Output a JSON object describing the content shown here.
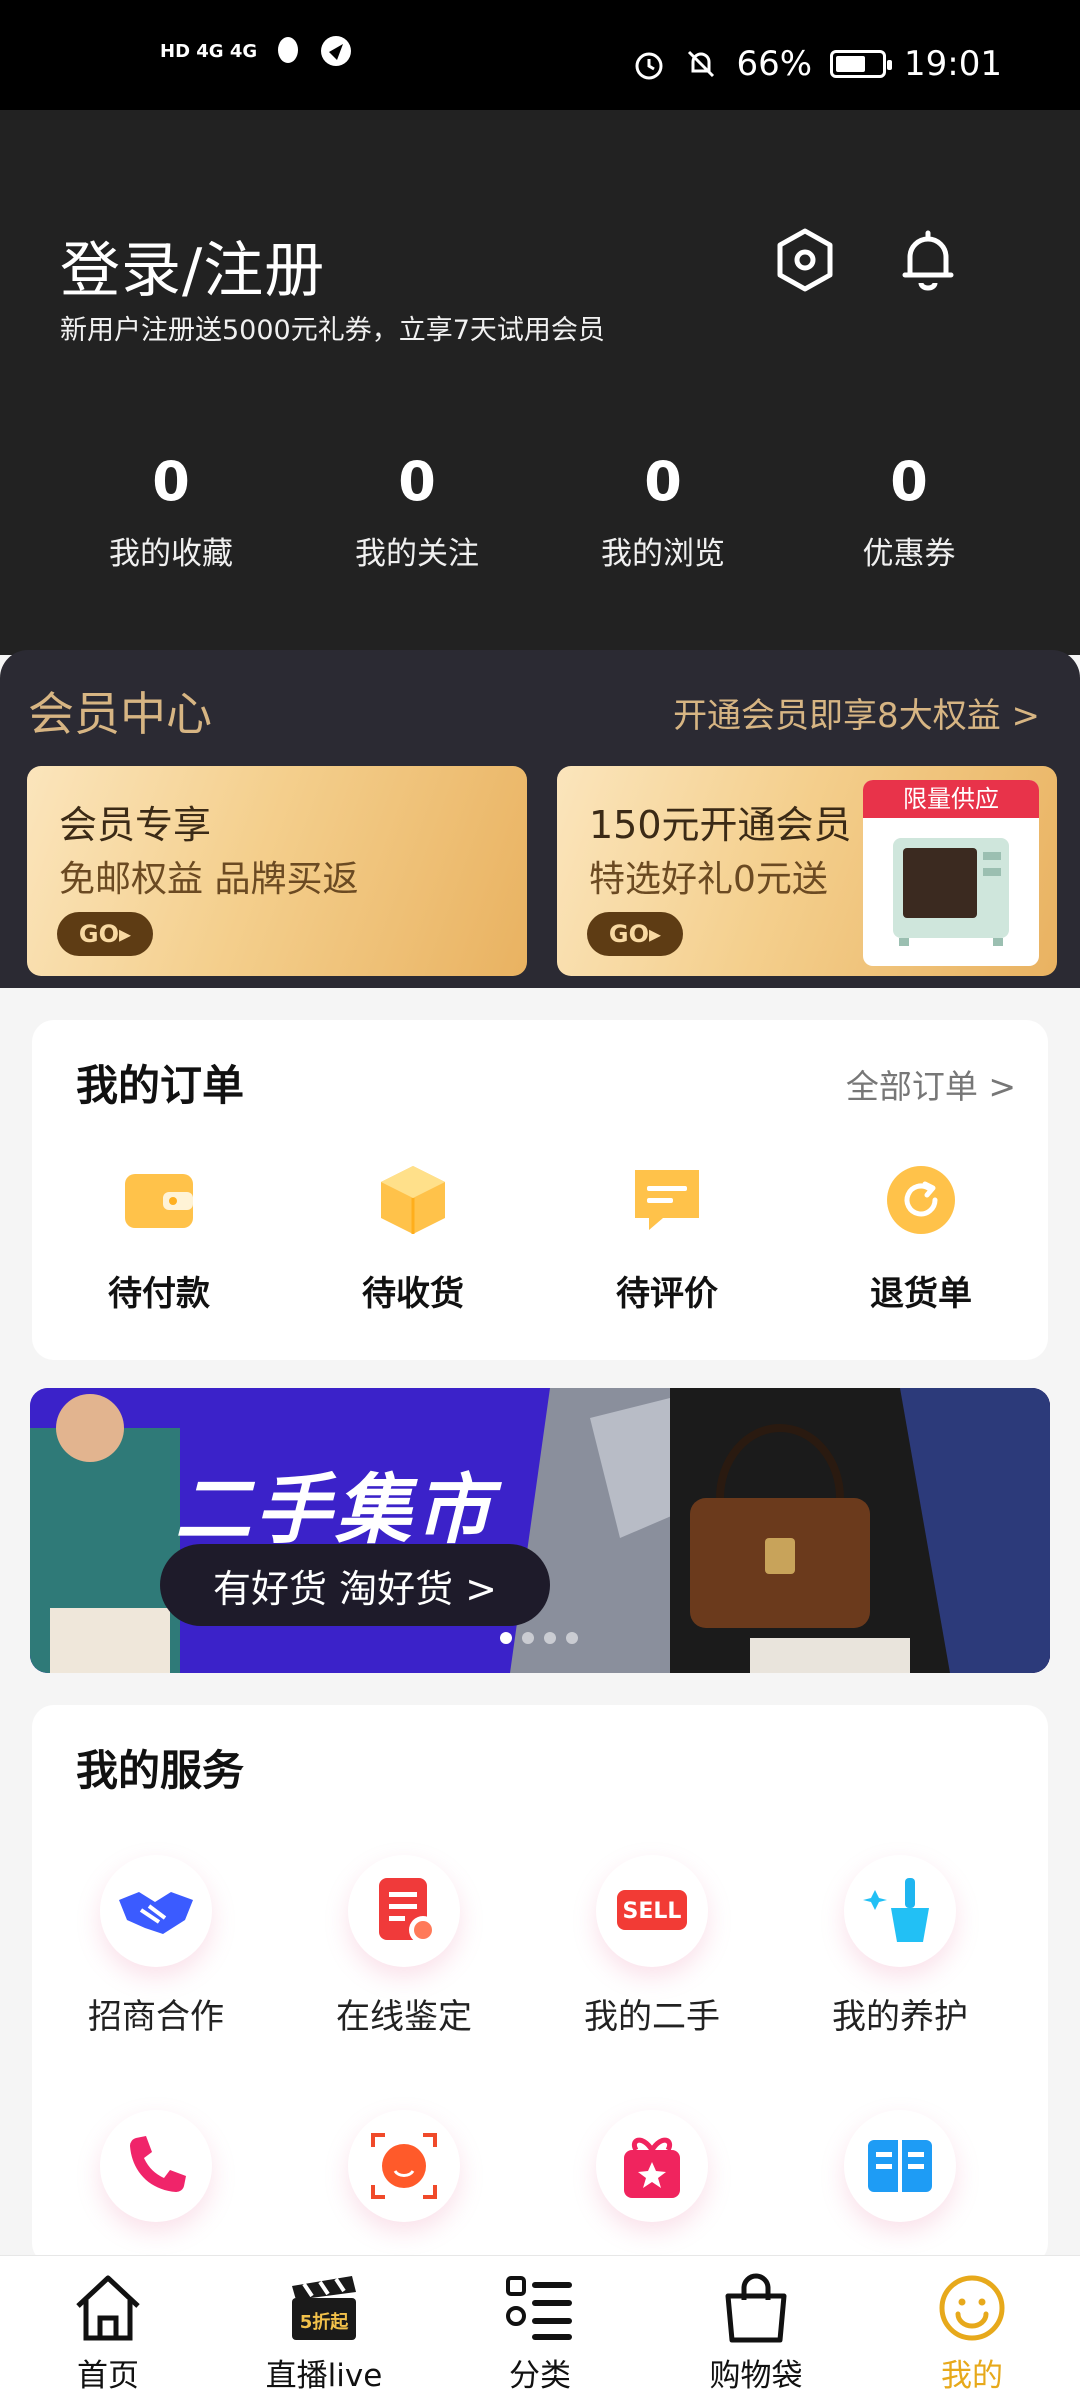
{
  "status_bar": {
    "network_left": "HD 4G 4G",
    "battery_percent_text": "66%",
    "battery_level": 0.66,
    "time": "19:01",
    "icons": [
      "alarm-icon",
      "mute-icon",
      "battery-icon",
      "qq-icon",
      "notification-icon"
    ]
  },
  "header": {
    "login_title": "登录/注册",
    "promo_text": "新用户注册送5000元礼券，立享7天试用会员",
    "icons": [
      "settings-hexagon-icon",
      "bell-icon"
    ],
    "stats": [
      {
        "value": "0",
        "label": "我的收藏"
      },
      {
        "value": "0",
        "label": "我的关注"
      },
      {
        "value": "0",
        "label": "我的浏览"
      },
      {
        "value": "0",
        "label": "优惠券"
      }
    ]
  },
  "member": {
    "title": "会员中心",
    "link": "开通会员即享8大权益 >",
    "cards": [
      {
        "title": "会员专享",
        "subtitle": "免邮权益 品牌买返",
        "go": "GO▸"
      },
      {
        "title": "150元开通会员",
        "subtitle": "特选好礼0元送",
        "go": "GO▸",
        "tag": "限量供应"
      }
    ]
  },
  "orders": {
    "title": "我的订单",
    "link": "全部订单 >",
    "items": [
      {
        "label": "待付款",
        "icon": "wallet-icon"
      },
      {
        "label": "待收货",
        "icon": "package-icon"
      },
      {
        "label": "待评价",
        "icon": "comment-icon"
      },
      {
        "label": "退货单",
        "icon": "return-icon"
      }
    ]
  },
  "banner": {
    "title": "二手集市",
    "pill": "有好货 淘好货 >"
  },
  "services": {
    "title": "我的服务",
    "items": [
      {
        "label": "招商合作",
        "icon": "handshake-icon"
      },
      {
        "label": "在线鉴定",
        "icon": "appraisal-icon"
      },
      {
        "label": "我的二手",
        "icon": "sell-icon"
      },
      {
        "label": "我的养护",
        "icon": "care-brush-icon"
      },
      {
        "label": "",
        "icon": "phone-icon"
      },
      {
        "label": "",
        "icon": "camera-scan-icon"
      },
      {
        "label": "",
        "icon": "gift-icon"
      },
      {
        "label": "",
        "icon": "book-icon"
      }
    ]
  },
  "bottom_nav": {
    "items": [
      {
        "label": "首页",
        "icon": "home-icon"
      },
      {
        "label": "直播live",
        "icon": "live-clapper-icon",
        "badge": "5折起"
      },
      {
        "label": "分类",
        "icon": "category-icon"
      },
      {
        "label": "购物袋",
        "icon": "bag-icon"
      },
      {
        "label": "我的",
        "icon": "smile-icon"
      }
    ],
    "active_index": 4,
    "active_color": "#e7a91b"
  }
}
